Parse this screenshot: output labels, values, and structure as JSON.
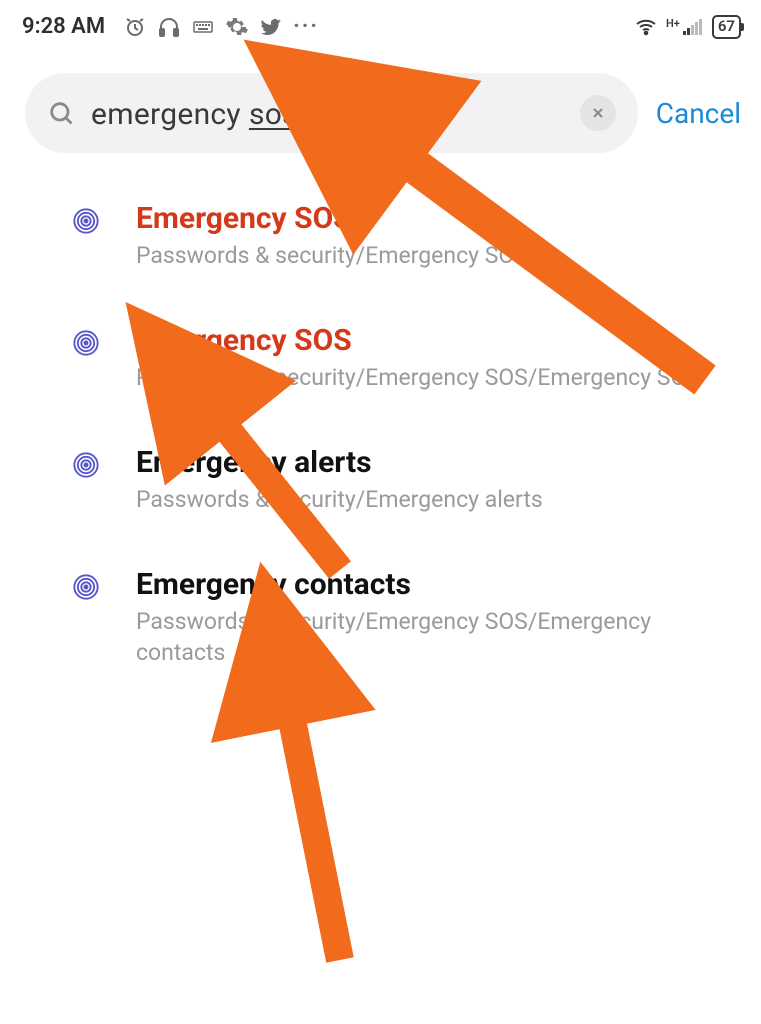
{
  "status": {
    "time": "9:28 AM",
    "battery": "67",
    "network_type": "H+"
  },
  "search": {
    "query_part1": "emergency",
    "query_part2": "sos",
    "cancel_label": "Cancel"
  },
  "results": [
    {
      "title": "Emergency SOS",
      "highlight": true,
      "path_prefix": "Passwords & security/Emergency SO",
      "path_suffix": ""
    },
    {
      "title": "Emergency SOS",
      "highlight": true,
      "path_prefix": "Passwords & security/Emergency SOS/Emergency SO",
      "path_suffix": ""
    },
    {
      "title": "Emergency alerts",
      "highlight": false,
      "path_prefix": "Passwords & security/Emergency alerts",
      "path_suffix": ""
    },
    {
      "title": "Emergency contacts",
      "highlight": false,
      "path_prefix": "Passwords & security/Emergency SOS/Emergency contacts",
      "path_suffix": ""
    }
  ],
  "colors": {
    "arrow": "#f26a1b",
    "highlight_text": "#d43a1a",
    "link": "#1a8ad6"
  }
}
